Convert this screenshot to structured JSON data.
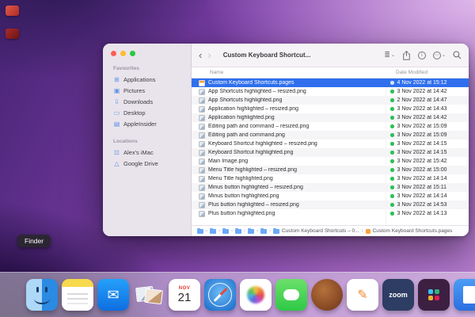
{
  "desktop": {
    "tooltip": "Finder"
  },
  "colors": {
    "selection": "#2f6fed",
    "pages_accent": "#f7a33b",
    "sync_dot": "#2fbf58"
  },
  "window": {
    "title": "Custom Keyboard Shortcut...",
    "toolbar": {
      "back": "‹",
      "forward": "›",
      "view_glyph": "≣",
      "chevron": "⌄",
      "info_glyph": "i",
      "more_glyph": "⋯"
    },
    "sidebar": {
      "favourites": {
        "label": "Favourites",
        "items": [
          {
            "label": "Applications",
            "glyph": "⊞"
          },
          {
            "label": "Pictures",
            "glyph": "▣"
          },
          {
            "label": "Downloads",
            "glyph": "⇩"
          },
          {
            "label": "Desktop",
            "glyph": "▭"
          },
          {
            "label": "AppleInsider",
            "glyph": "▤"
          }
        ]
      },
      "locations": {
        "label": "Locations",
        "items": [
          {
            "label": "Alex's iMac",
            "glyph": "⊡"
          },
          {
            "label": "Google Drive",
            "glyph": "△"
          }
        ]
      }
    },
    "columns": {
      "name": "Name",
      "date": "Date Modified"
    },
    "files": [
      {
        "name": "Custom Keyboard Shortcuts.pages",
        "date": "4 Nov 2022 at 15:12",
        "type": "pages",
        "selected": true
      },
      {
        "name": "App Shortcuts highlighted – resized.png",
        "date": "3 Nov 2022 at 14:42",
        "type": "png"
      },
      {
        "name": "App Shortcuts highlighted.png",
        "date": "2 Nov 2022 at 14:47",
        "type": "png"
      },
      {
        "name": "Application highlighted – resized.png",
        "date": "3 Nov 2022 at 14:43",
        "type": "png"
      },
      {
        "name": "Application highlighted.png",
        "date": "3 Nov 2022 at 14:42",
        "type": "png"
      },
      {
        "name": "Editing path and command – resized.png",
        "date": "3 Nov 2022 at 15:09",
        "type": "png"
      },
      {
        "name": "Editing path and command.png",
        "date": "3 Nov 2022 at 15:09",
        "type": "png"
      },
      {
        "name": "Keyboard Shortcut highlighted – resized.png",
        "date": "3 Nov 2022 at 14:15",
        "type": "png"
      },
      {
        "name": "Keyboard Shortcut highlighted.png",
        "date": "3 Nov 2022 at 14:15",
        "type": "png"
      },
      {
        "name": "Main Image.png",
        "date": "3 Nov 2022 at 15:42",
        "type": "png"
      },
      {
        "name": "Menu Title highlighted – resized.png",
        "date": "3 Nov 2022 at 15:00",
        "type": "png"
      },
      {
        "name": "Menu Title highlighted.png",
        "date": "3 Nov 2022 at 14:14",
        "type": "png"
      },
      {
        "name": "Minus button highlighted – resized.png",
        "date": "3 Nov 2022 at 15:11",
        "type": "png"
      },
      {
        "name": "Minus button highlighted.png",
        "date": "3 Nov 2022 at 14:14",
        "type": "png"
      },
      {
        "name": "Plus button highlighted – resized.png",
        "date": "3 Nov 2022 at 14:53",
        "type": "png"
      },
      {
        "name": "Plus button highlighted.png",
        "date": "3 Nov 2022 at 14:13",
        "type": "png"
      }
    ],
    "pathbar": {
      "folder_label": "Custom Keyboard Shortcuts – 0...",
      "file_label": "Custom Keyboard Shortcuts.pages"
    }
  },
  "dock": {
    "items": [
      "finder",
      "notes",
      "mail",
      "preview",
      "calendar",
      "safari",
      "photos",
      "messages",
      "podcasts",
      "pages",
      "zoom",
      "slack",
      "docs"
    ],
    "calendar": {
      "month": "NOV",
      "day": "21"
    },
    "zoom_label": "zoom"
  }
}
